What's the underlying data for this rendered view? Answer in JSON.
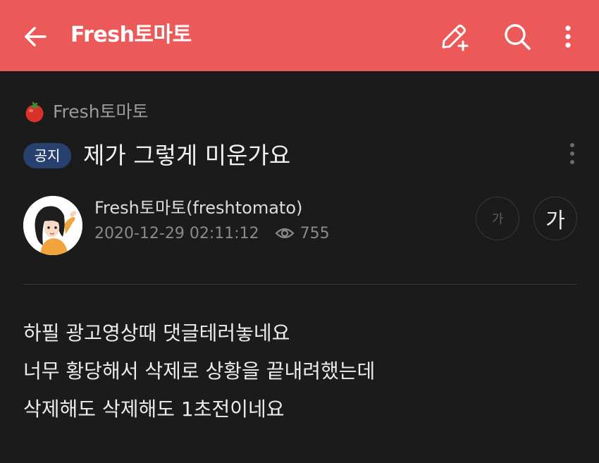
{
  "appbar": {
    "title": "Fresh토마토",
    "icons": [
      "back-arrow-icon",
      "edit-pen-icon",
      "search-icon",
      "more-vertical-icon"
    ],
    "background": "#eb5a58"
  },
  "board": {
    "icon": "tomato-icon",
    "name": "Fresh토마토"
  },
  "post": {
    "badge": "공지",
    "title": "제가 그렇게 미운가요",
    "author": "Fresh토마토(freshtomato)",
    "date": "2020-12-29 02:11:12",
    "views": "755",
    "font_small_label": "가",
    "font_large_label": "가",
    "body": [
      "하필 광고영상때 댓글테러놓네요",
      "너무 황당해서 삭제로 상황을 끝내려했는데",
      "삭제해도 삭제해도 1초전이네요"
    ]
  },
  "colors": {
    "accent": "#eb5a58",
    "badge": "#28406e",
    "background": "#1b1b1b"
  }
}
